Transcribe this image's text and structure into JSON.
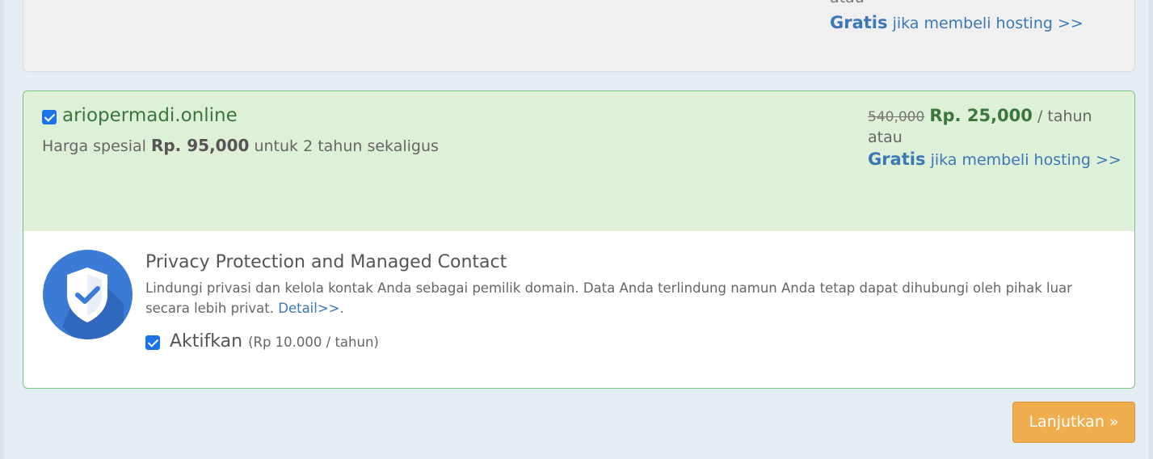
{
  "previous_domain": {
    "atau": "atau",
    "gratis": "Gratis",
    "gratis_link": "jika membeli hosting >>"
  },
  "domain": {
    "name": "ariopermadi.online",
    "checked": true,
    "special_prefix": "Harga spesial",
    "special_price": "Rp. 95,000",
    "special_suffix": "untuk 2 tahun sekaligus",
    "old_price": "540,000",
    "new_price": "Rp. 25,000",
    "per_year": "/ tahun",
    "atau": "atau",
    "gratis": "Gratis",
    "gratis_link": "jika membeli hosting >>"
  },
  "privacy": {
    "title": "Privacy Protection and Managed Contact",
    "description": "Lindungi privasi dan kelola kontak Anda sebagai pemilik domain. Data Anda terlindung namun Anda tetap dapat dihubungi oleh pihak luar secara lebih privat.",
    "detail_link": "Detail>>",
    "period": ".",
    "enable_label": "Aktifkan",
    "enable_price": "(Rp 10.000 / tahun)",
    "enabled": true,
    "icon": "shield-check-icon"
  },
  "actions": {
    "continue_label": "Lanjutkan »"
  },
  "colors": {
    "card_border": "#7cc27c",
    "card_head_bg": "#dff0d8",
    "domain_green": "#3b763d",
    "link_blue": "#3a78b8",
    "button_orange": "#f0ad4e",
    "shield_blue": "#3a7bd5"
  }
}
